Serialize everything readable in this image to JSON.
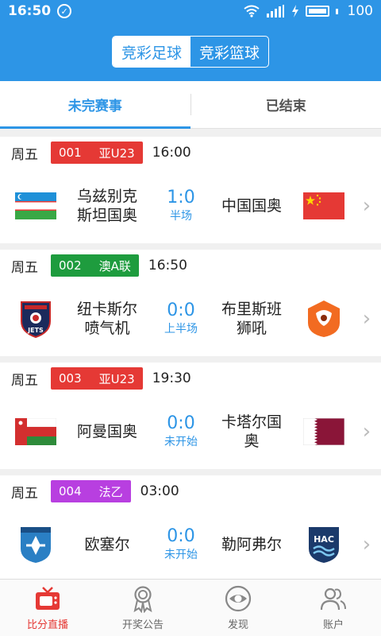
{
  "status_bar": {
    "time": "16:50",
    "battery": "100"
  },
  "header": {
    "segments": [
      {
        "label": "竞彩足球",
        "active": true
      },
      {
        "label": "竞彩篮球",
        "active": false
      }
    ]
  },
  "tabs": [
    {
      "label": "未完赛事",
      "active": true
    },
    {
      "label": "已结束",
      "active": false
    }
  ],
  "matches": [
    {
      "day": "周五",
      "number": "001",
      "league": "亚U23",
      "league_color": "#e53935",
      "time": "16:00",
      "home": "乌兹别克斯坦国奥",
      "home_lines": [
        "乌兹别克",
        "斯坦国奥"
      ],
      "score": "1:0",
      "status": "半场",
      "away": "中国国奥",
      "away_lines": [
        "中国国奥"
      ]
    },
    {
      "day": "周五",
      "number": "002",
      "league": "澳A联",
      "league_color": "#1e9c3e",
      "time": "16:50",
      "home": "纽卡斯尔喷气机",
      "home_lines": [
        "纽卡斯尔",
        "喷气机"
      ],
      "score": "0:0",
      "status": "上半场",
      "away": "布里斯班狮吼",
      "away_lines": [
        "布里斯班",
        "狮吼"
      ]
    },
    {
      "day": "周五",
      "number": "003",
      "league": "亚U23",
      "league_color": "#e53935",
      "time": "19:30",
      "home": "阿曼国奥",
      "home_lines": [
        "阿曼国奥"
      ],
      "score": "0:0",
      "status": "未开始",
      "away": "卡塔尔国奥",
      "away_lines": [
        "卡塔尔国",
        "奥"
      ]
    },
    {
      "day": "周五",
      "number": "004",
      "league": "法乙",
      "league_color": "#b83fe0",
      "time": "03:00",
      "home": "欧塞尔",
      "home_lines": [
        "欧塞尔"
      ],
      "score": "0:0",
      "status": "未开始",
      "away": "勒阿弗尔",
      "away_lines": [
        "勒阿弗尔"
      ]
    }
  ],
  "crest_text": {
    "jets": "JETS",
    "hac": "HAC"
  },
  "bottom_nav": [
    {
      "label": "比分直播",
      "icon": "tv-icon",
      "active": true
    },
    {
      "label": "开奖公告",
      "icon": "award-icon",
      "active": false
    },
    {
      "label": "发现",
      "icon": "eye-icon",
      "active": false
    },
    {
      "label": "账户",
      "icon": "users-icon",
      "active": false
    }
  ],
  "colors": {
    "primary": "#2d95e6",
    "active_nav": "#e53935"
  }
}
